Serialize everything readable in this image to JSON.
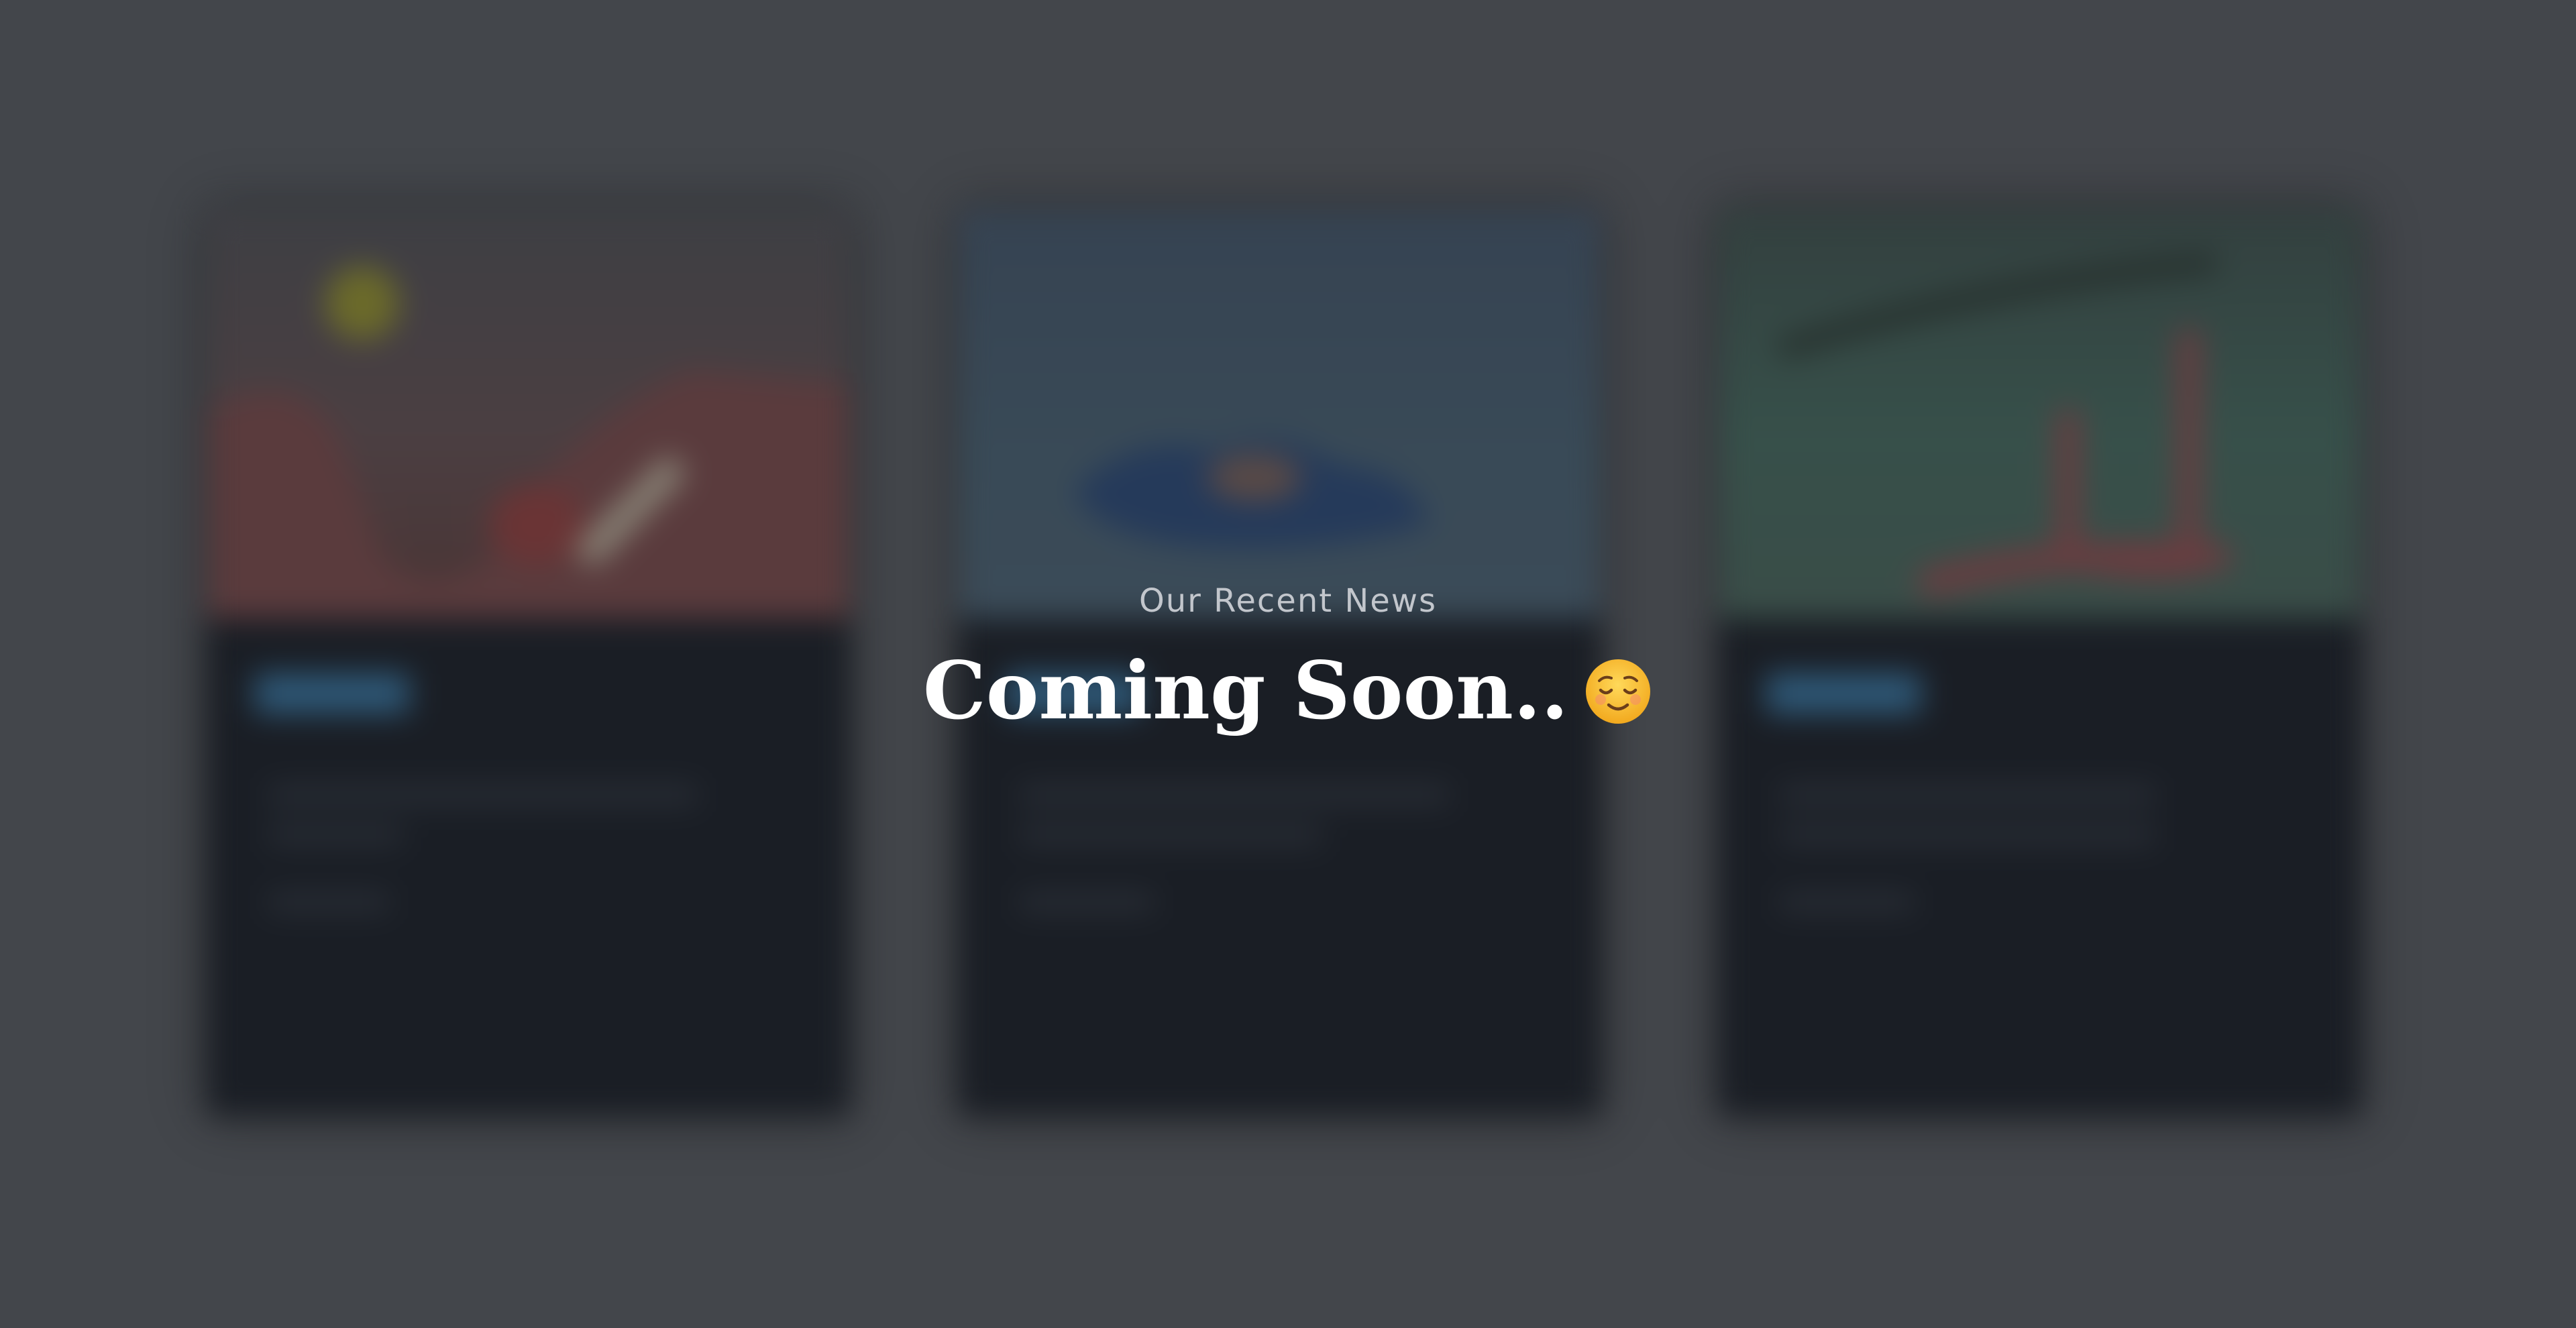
{
  "section": {
    "subtitle": "Our Recent News",
    "headline": "Coming Soon.."
  },
  "icons": {
    "headline_emoji": "relieved-face-icon"
  },
  "colors": {
    "page_background": "#43464b",
    "card_body": "#1a1e25",
    "tag_blue": "#2e5877",
    "subtitle_text": "#c2c6cc",
    "headline_text": "#ffffff"
  }
}
